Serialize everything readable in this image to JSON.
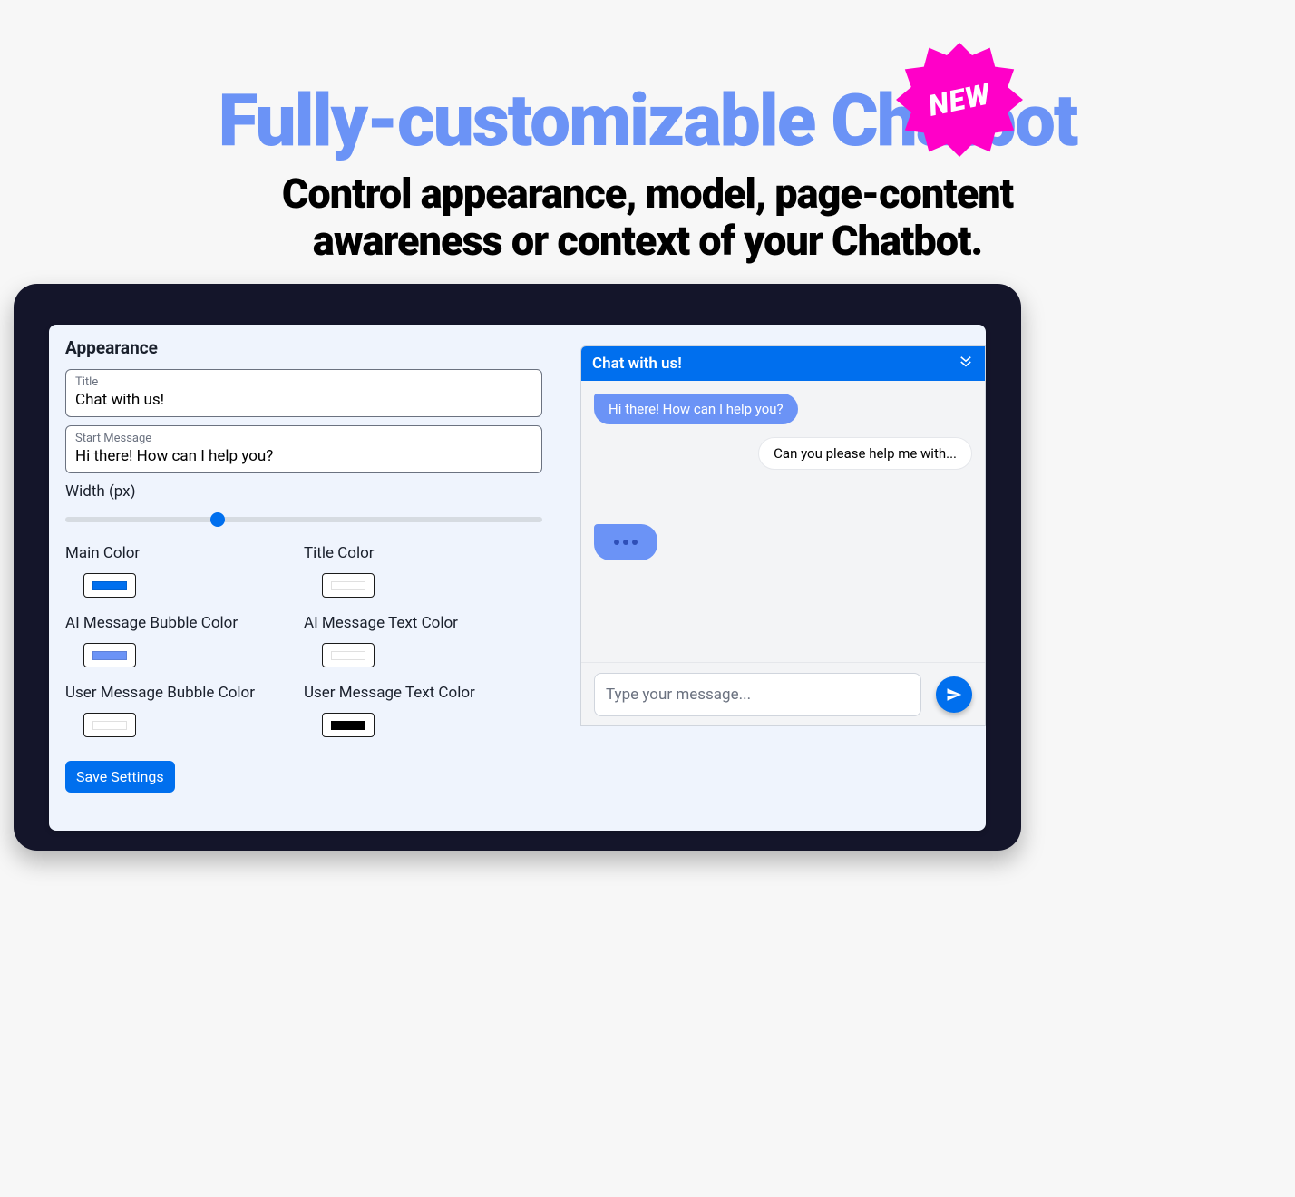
{
  "hero": {
    "title": "Fully-customizable Chatbot",
    "subtitle": "Control appearance, model, page-content awareness or context of your Chatbot.",
    "badge": "NEW"
  },
  "settings": {
    "section": "Appearance",
    "title_field": {
      "label": "Title",
      "value": "Chat with us!"
    },
    "start_message": {
      "label": "Start Message",
      "value": "Hi there! How can I help you?"
    },
    "width_label": "Width (px)",
    "width_percent": 32,
    "colors": {
      "main": {
        "label": "Main Color",
        "hex": "#006fee"
      },
      "title": {
        "label": "Title Color",
        "hex": "#ffffff"
      },
      "ai_bubble": {
        "label": "AI Message Bubble Color",
        "hex": "#6b93f6"
      },
      "ai_text": {
        "label": "AI Message Text Color",
        "hex": "#ffffff"
      },
      "user_bubble": {
        "label": "User Message Bubble Color",
        "hex": "#ffffff"
      },
      "user_text": {
        "label": "User Message Text Color",
        "hex": "#000000"
      }
    },
    "save": "Save Settings"
  },
  "chat": {
    "title": "Chat with us!",
    "ai_msg": "Hi there! How can I help you?",
    "user_msg": "Can you please help me with...",
    "placeholder": "Type your message..."
  }
}
